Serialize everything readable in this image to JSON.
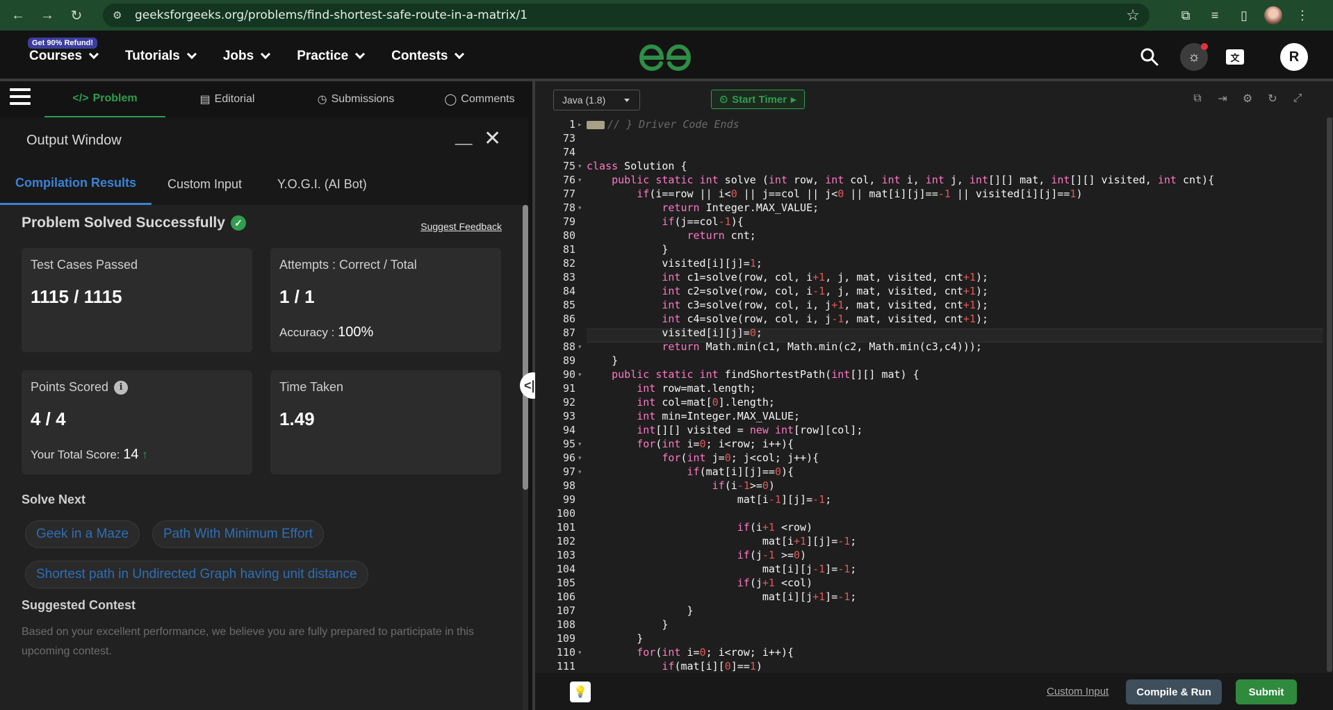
{
  "browser": {
    "url": "geeksforgeeks.org/problems/find-shortest-safe-route-in-a-matrix/1"
  },
  "header": {
    "refund_badge": "Get 90% Refund!",
    "nav": [
      "Courses",
      "Tutorials",
      "Jobs",
      "Practice",
      "Contests"
    ],
    "avatar_letter": "R",
    "brand_color": "#2f8d46"
  },
  "problem_tabs": [
    {
      "label": "Problem",
      "icon": "code-icon"
    },
    {
      "label": "Editorial",
      "icon": "document-icon"
    },
    {
      "label": "Submissions",
      "icon": "clock-icon"
    },
    {
      "label": "Comments",
      "icon": "comment-icon"
    }
  ],
  "output": {
    "title": "Output Window",
    "minimize": "__",
    "close": "✕",
    "tabs": [
      "Compilation Results",
      "Custom Input",
      "Y.O.G.I. (AI Bot)"
    ],
    "status": "Problem Solved Successfully",
    "feedback": "Suggest Feedback",
    "cards": {
      "tests_label": "Test Cases Passed",
      "tests_value": "1115 / 1115",
      "attempts_label": "Attempts : Correct / Total",
      "attempts_value": "1 / 1",
      "accuracy_label": "Accuracy :",
      "accuracy_value": "100%",
      "points_label": "Points Scored",
      "points_value": "4 / 4",
      "total_label": "Your Total Score:",
      "total_value": "14",
      "time_label": "Time Taken",
      "time_value": "1.49"
    },
    "solve_next_title": "Solve Next",
    "solve_next": [
      "Geek in a Maze",
      "Path With Minimum Effort",
      "Shortest path in Undirected Graph having unit distance"
    ],
    "suggested_title": "Suggested Contest",
    "suggested_text": "Based on your excellent performance, we believe you are fully prepared to participate in this upcoming contest."
  },
  "editor": {
    "language": "Java (1.8)",
    "timer": "Start Timer",
    "custom_input": "Custom Input",
    "compile": "Compile & Run",
    "submit": "Submit",
    "line_numbers": [
      "1",
      "73",
      "74",
      "75",
      "76",
      "77",
      "78",
      "79",
      "80",
      "81",
      "82",
      "83",
      "84",
      "85",
      "86",
      "87",
      "88",
      "89",
      "90",
      "91",
      "92",
      "93",
      "94",
      "95",
      "96",
      "97",
      "98",
      "99",
      "100",
      "101",
      "102",
      "103",
      "104",
      "105",
      "106",
      "107",
      "108",
      "109",
      "110",
      "111"
    ]
  }
}
